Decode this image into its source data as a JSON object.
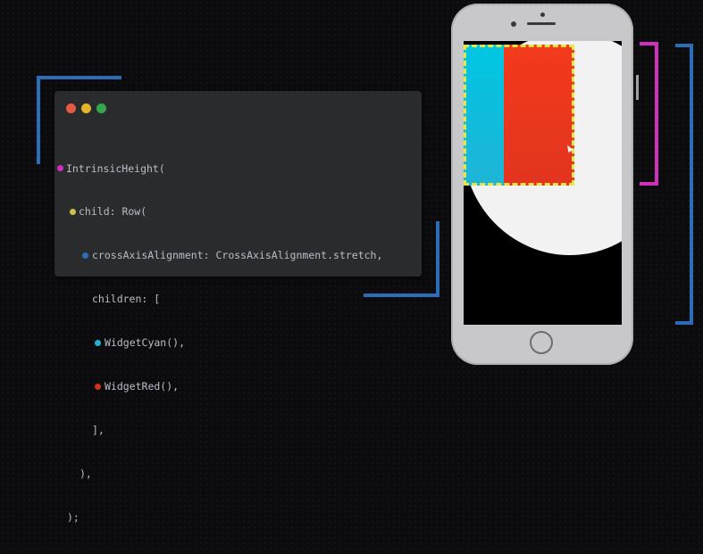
{
  "colors": {
    "background": "#0b0b0d",
    "accent_blue": "#2a6db8",
    "accent_magenta": "#d02fbd",
    "code_window": "#2a2b2d",
    "code_text": "#b9bec6",
    "widget_cyan": "#00c6e3",
    "widget_red": "#f33a1c",
    "dash_yellow": "#e8e545"
  },
  "window_controls": [
    {
      "name": "close",
      "color": "#e65a44"
    },
    {
      "name": "minimize",
      "color": "#e3b52b"
    },
    {
      "name": "maximize",
      "color": "#34a84e"
    }
  ],
  "code": {
    "lines": [
      {
        "text": "IntrinsicHeight(",
        "marker": "#d02fbd"
      },
      {
        "text": "child: Row(",
        "marker": "#c9c24a"
      },
      {
        "text": "crossAxisAlignment: CrossAxisAlignment.stretch,",
        "marker": "#2a6db8"
      },
      {
        "text": "children: [",
        "marker": ""
      },
      {
        "text": "WidgetCyan(),",
        "marker": "#1fb4d6"
      },
      {
        "text": "WidgetRed(),",
        "marker": "#d2301b"
      },
      {
        "text": "],",
        "marker": ""
      },
      {
        "text": "),",
        "marker": ""
      },
      {
        "text": ");",
        "marker": ""
      }
    ]
  }
}
